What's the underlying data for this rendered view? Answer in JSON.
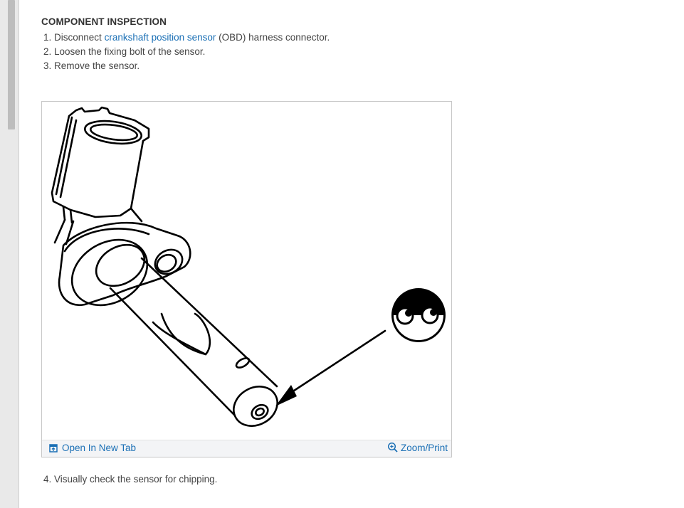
{
  "section": {
    "title": "COMPONENT INSPECTION"
  },
  "steps": [
    {
      "number": "1.",
      "before": "Disconnect ",
      "link": "crankshaft position sensor",
      "after": " (OBD) harness connector."
    },
    {
      "number": "2.",
      "text": "Loosen the fixing bolt of the sensor."
    },
    {
      "number": "3.",
      "text": "Remove the sensor."
    }
  ],
  "figure": {
    "open_tab_label": "Open In New Tab",
    "zoom_label": "Zoom/Print",
    "open_tab_icon": "open-new-tab-icon",
    "zoom_icon": "zoom-in-icon"
  },
  "step4": {
    "number": "4.",
    "text": "Visually check the sensor for chipping."
  },
  "colors": {
    "link": "#1a6fb5",
    "text": "#333333",
    "bar_bg": "#f3f4f6"
  }
}
